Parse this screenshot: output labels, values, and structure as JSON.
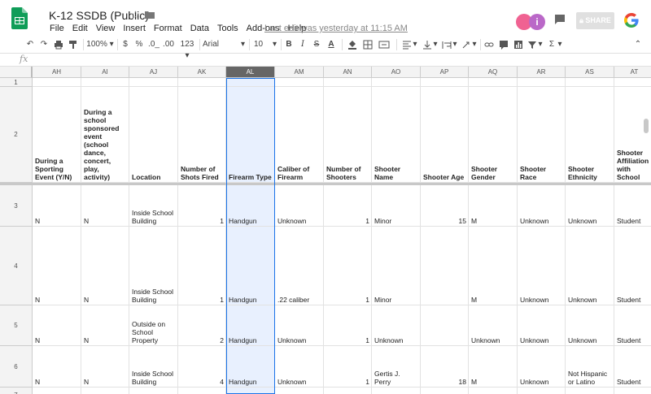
{
  "app": {
    "title": "K-12 SSDB (Public)",
    "last_edit": "Last edit was yesterday at 11:15 AM",
    "share_label": "SHARE",
    "avatar_b_initial": "i"
  },
  "menu": [
    "File",
    "Edit",
    "View",
    "Insert",
    "Format",
    "Data",
    "Tools",
    "Add-ons",
    "Help"
  ],
  "toolbar": {
    "zoom": "100%",
    "currency": "$",
    "percent": "%",
    "dec_less": ".0_",
    "dec_more": ".00",
    "more_formats": "123",
    "font": "Arial",
    "size": "10",
    "bold": "B",
    "italic": "I",
    "strike": "S",
    "text_color": "A",
    "sigma": "Σ"
  },
  "formula_bar": {
    "label": "fx"
  },
  "columns": [
    {
      "id": "AH"
    },
    {
      "id": "AI"
    },
    {
      "id": "AJ"
    },
    {
      "id": "AK"
    },
    {
      "id": "AL"
    },
    {
      "id": "AM"
    },
    {
      "id": "AN"
    },
    {
      "id": "AO"
    },
    {
      "id": "AP"
    },
    {
      "id": "AQ"
    },
    {
      "id": "AR"
    },
    {
      "id": "AS"
    },
    {
      "id": "AT"
    }
  ],
  "selected_column": "AL",
  "rows": [
    {
      "num": "1",
      "cells": [
        "",
        "",
        "",
        "",
        "",
        "",
        "",
        "",
        "",
        "",
        "",
        "",
        ""
      ]
    },
    {
      "num": "2",
      "header": true,
      "cells": [
        "During a Sporting Event (Y/N)",
        "During a school sponsored event (school dance, concert, play, activity)",
        "Location",
        "Number of Shots Fired",
        "Firearm Type",
        "Caliber of Firearm",
        "Number of Shooters",
        "Shooter Name",
        "Shooter Age",
        "Shooter Gender",
        "Shooter Race",
        "Shooter Ethnicity",
        "Shooter Affiliation with School"
      ]
    },
    {
      "num": "3",
      "cells": [
        "N",
        "N",
        "Inside School Building",
        "1",
        "Handgun",
        "Unknown",
        "1",
        "Minor",
        "15",
        "M",
        "Unknown",
        "Unknown",
        "Student"
      ]
    },
    {
      "num": "4",
      "cells": [
        "N",
        "N",
        "Inside School Building",
        "1",
        "Handgun",
        ".22 caliber",
        "1",
        "Minor",
        "",
        "M",
        "Unknown",
        "Unknown",
        "Student"
      ]
    },
    {
      "num": "5",
      "cells": [
        "N",
        "N",
        "Outside on School Property",
        "2",
        "Handgun",
        "Unknown",
        "1",
        "Unknown",
        "",
        "Unknown",
        "Unknown",
        "Unknown",
        "Student"
      ]
    },
    {
      "num": "6",
      "cells": [
        "N",
        "N",
        "Inside School Building",
        "4",
        "Handgun",
        "Unknown",
        "1",
        "Gertis J. Perry",
        "18",
        "M",
        "Unknown",
        "Not Hispanic or Latino",
        "Student"
      ]
    },
    {
      "num": "7",
      "cells": [
        "",
        "",
        "",
        "",
        "",
        "",
        "",
        "",
        "",
        "",
        "",
        "",
        ""
      ]
    }
  ],
  "colors": {
    "accent": "#1a73e8",
    "sheets_green": "#0f9d58",
    "selected_header": "#666666",
    "selected_fill": "#e8f0fe"
  }
}
